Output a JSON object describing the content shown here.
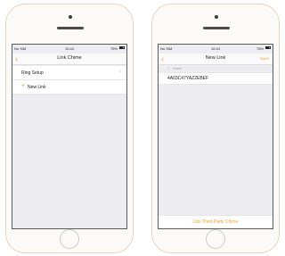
{
  "left_screen": {
    "status": {
      "carrier": "No SIM",
      "time": "10:44",
      "battery": "75%",
      "battery_fraction": 0.75
    },
    "nav": {
      "back_icon": "chevron-left-icon",
      "title": "Link Chime"
    },
    "rows": [
      {
        "label": "Ring Setup"
      },
      {
        "label": "New Link"
      }
    ]
  },
  "right_screen": {
    "status": {
      "carrier": "No SIM",
      "time": "10:44",
      "battery": "75%",
      "battery_fraction": 0.75
    },
    "nav": {
      "back_icon": "chevron-left-icon",
      "title": "New Link",
      "action": "Save"
    },
    "section": {
      "label": "Chime",
      "icon": "chime-icon"
    },
    "device_id": "4A03C47YAZ2EBEF",
    "footer_link": "Link Third Party Chime"
  },
  "colors": {
    "accent": "#f0a030",
    "background": "#ececf1"
  }
}
